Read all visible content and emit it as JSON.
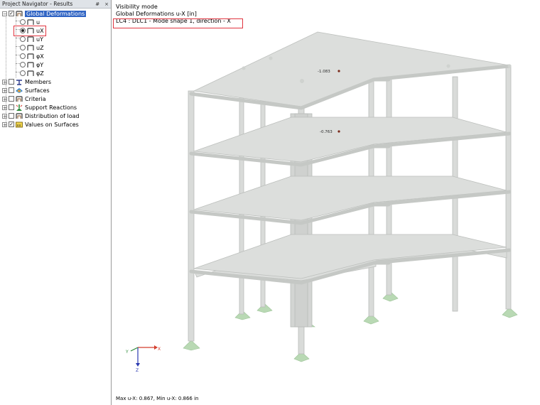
{
  "navigator": {
    "title": "Project Navigator - Results",
    "pin": "#",
    "close": "×",
    "root": {
      "label": "Global Deformations",
      "checked": true
    },
    "components": [
      {
        "label": "u"
      },
      {
        "label": "uX"
      },
      {
        "label": "uY"
      },
      {
        "label": "uZ"
      },
      {
        "label": "φX"
      },
      {
        "label": "φY"
      },
      {
        "label": "φZ"
      }
    ],
    "selected_component": "uX",
    "groups": [
      {
        "label": "Members",
        "checked": false
      },
      {
        "label": "Surfaces",
        "checked": false
      },
      {
        "label": "Criteria",
        "checked": false
      },
      {
        "label": "Support Reactions",
        "checked": false
      },
      {
        "label": "Distribution of load",
        "checked": false
      },
      {
        "label": "Values on Surfaces",
        "checked": true
      }
    ]
  },
  "view": {
    "info_line1": "Visibility mode",
    "info_line2": "Global Deformations u-X [in]",
    "info_line3": "LC4 : DLC1 - Mode shape 1, direction - X",
    "value_top": "-1.083",
    "value_mid": "-0.763",
    "footer": "Max u-X: 0.867, Min u-X: 0.866 in",
    "axis_x": "X",
    "axis_z": "Z",
    "axis_y": "Y"
  },
  "colors": {
    "structure": "#d9dbd9",
    "structure_edge": "#b9bcba",
    "support": "#b9d9b4",
    "selection": "#3064c4",
    "highlight": "#e0343f"
  }
}
